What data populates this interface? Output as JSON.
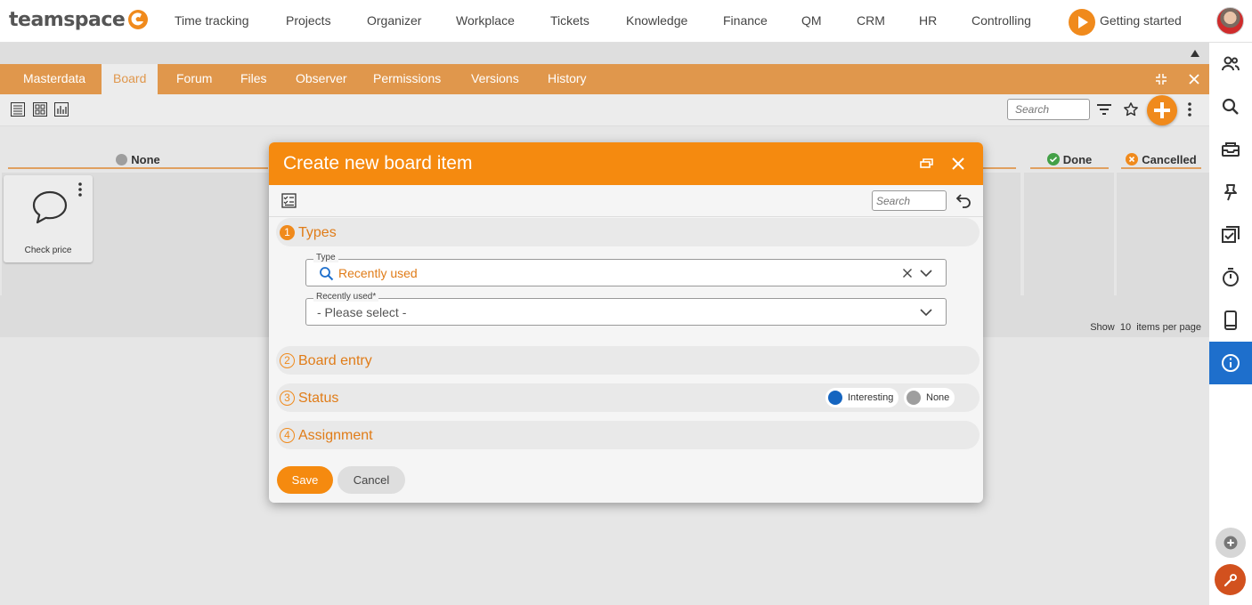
{
  "app": {
    "logo_text": "teamspace"
  },
  "topnav": {
    "items": [
      "Time tracking",
      "Projects",
      "Organizer",
      "Workplace",
      "Tickets",
      "Knowledge",
      "Finance",
      "QM",
      "CRM",
      "HR",
      "Controlling"
    ],
    "getting_started": "Getting started"
  },
  "tabs": {
    "items": [
      "Masterdata",
      "Board",
      "Forum",
      "Files",
      "Observer",
      "Permissions",
      "Versions",
      "History"
    ],
    "active": "Board"
  },
  "toolbar": {
    "search_placeholder": "Search"
  },
  "board": {
    "columns": [
      {
        "label": "None",
        "status_color": "#9e9e9e",
        "icon": "grey-dot-icon"
      },
      {
        "label": "Done",
        "status_color": "#43a047",
        "icon": "check-circle-icon"
      },
      {
        "label": "Cancelled",
        "status_color": "#f08a1c",
        "icon": "x-circle-icon"
      }
    ],
    "card": {
      "title": "Check price",
      "icon": "speech-bubble-icon"
    },
    "pagination": {
      "show": "Show",
      "count": "10",
      "suffix": "items per page"
    }
  },
  "modal": {
    "title": "Create new board item",
    "search_placeholder": "Search",
    "sections": [
      {
        "num": "1",
        "label": "Types"
      },
      {
        "num": "2",
        "label": "Board entry"
      },
      {
        "num": "3",
        "label": "Status"
      },
      {
        "num": "4",
        "label": "Assignment"
      }
    ],
    "type_field": {
      "label": "Type",
      "value": "Recently used"
    },
    "recent_field": {
      "label": "Recently used*",
      "placeholder": "- Please select -"
    },
    "status_chips": [
      {
        "label": "Interesting",
        "color": "#1565c0"
      },
      {
        "label": "None",
        "color": "#9e9e9e"
      }
    ],
    "save_label": "Save",
    "cancel_label": "Cancel"
  },
  "colors": {
    "accent": "#f58a0f",
    "tabbar": "#e0974c",
    "rail_active": "#1e6fcc"
  }
}
